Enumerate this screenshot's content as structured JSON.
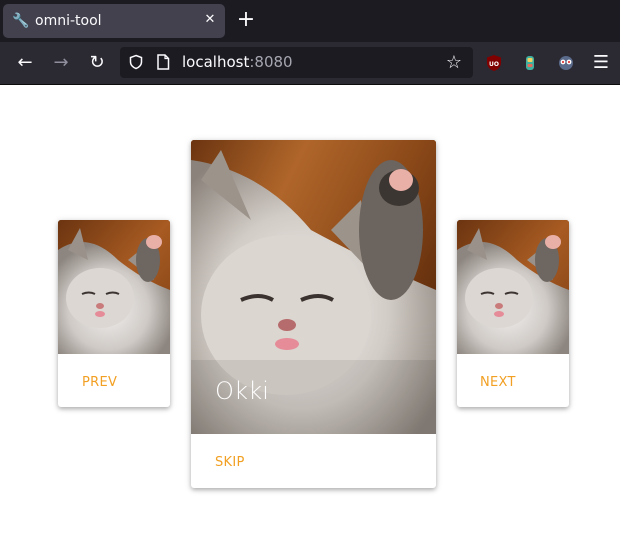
{
  "browser": {
    "tab_title": "omni-tool",
    "url_host": "localhost",
    "url_port": ":8080",
    "icons": {
      "favicon": "wrench-icon",
      "close": "close-icon",
      "new_tab": "plus-icon",
      "back": "arrow-left-icon",
      "forward": "arrow-right-icon",
      "reload": "reload-icon",
      "shield": "shield-icon",
      "page": "page-icon",
      "bookmark": "star-icon",
      "menu": "hamburger-menu-icon"
    },
    "extensions": [
      "ublock-origin-icon",
      "extension-icon",
      "extension-icon"
    ]
  },
  "carousel": {
    "left_card": {
      "action_label": "PREV"
    },
    "center_card": {
      "caption": "Okki",
      "action_label": "SKIP"
    },
    "right_card": {
      "action_label": "NEXT"
    }
  },
  "colors": {
    "accent": "#f2a023",
    "chrome_dark": "#1c1b22",
    "chrome_toolbar": "#2b2a33",
    "tab_active": "#42414d"
  }
}
